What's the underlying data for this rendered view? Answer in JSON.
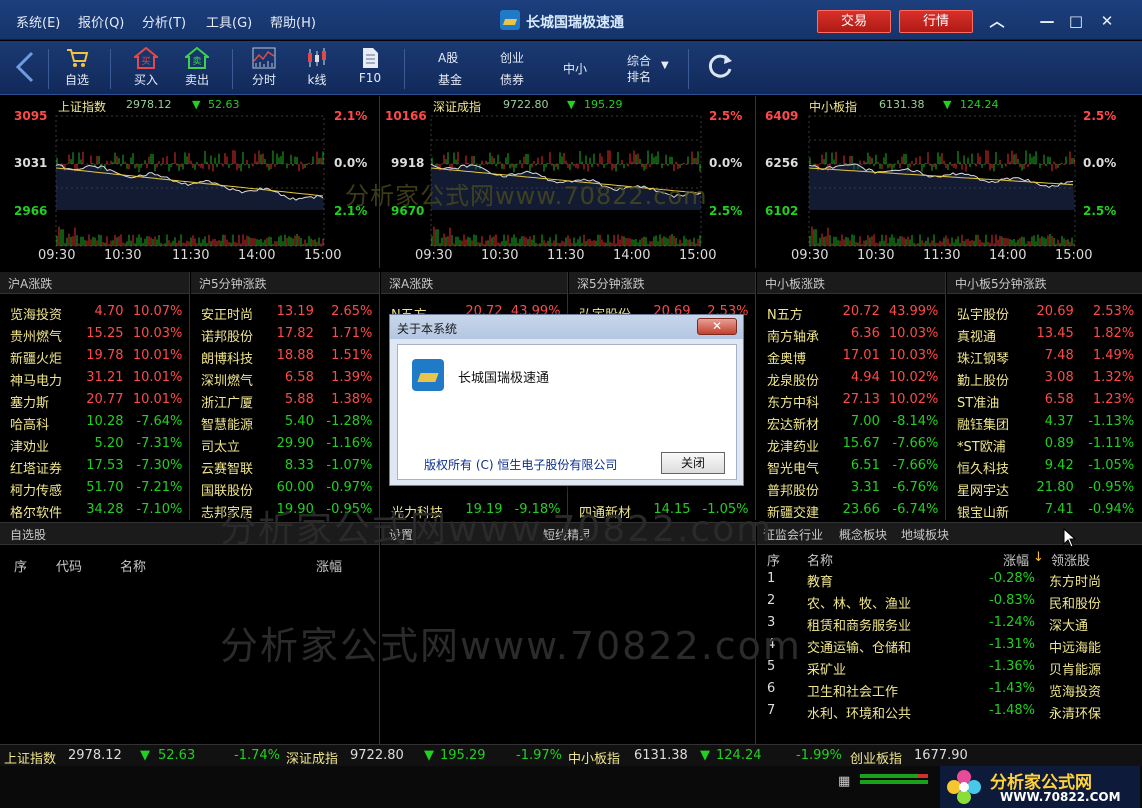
{
  "menu": [
    "系统(E)",
    "报价(Q)",
    "分析(T)",
    "工具(G)",
    "帮助(H)"
  ],
  "app_title": "长城国瑞极速通",
  "buttons": {
    "trade": "交易",
    "quote": "行情"
  },
  "toolbar": {
    "watch": "自选",
    "buy": "买入",
    "sell": "卖出",
    "timeshare": "分时",
    "kline": "k线",
    "f10": "F10",
    "a_share": "A股",
    "fund": "基金",
    "gem": "创业",
    "bond": "债券",
    "small": "中小",
    "rank": "综合",
    "rank2": "排名"
  },
  "indices": [
    {
      "name": "上证指数",
      "value": "2978.12",
      "change": "52.63",
      "top": "3095",
      "mid": "3031",
      "bot": "2966",
      "pct_top": "2.1%",
      "pct_mid": "0.0%",
      "pct_bot": "2.1%"
    },
    {
      "name": "深证成指",
      "value": "9722.80",
      "change": "195.29",
      "top": "10166",
      "mid": "9918",
      "bot": "9670",
      "pct_top": "2.5%",
      "pct_mid": "0.0%",
      "pct_bot": "2.5%"
    },
    {
      "name": "中小板指",
      "value": "6131.38",
      "change": "124.24",
      "top": "6409",
      "mid": "6256",
      "bot": "6102",
      "pct_top": "2.5%",
      "pct_mid": "0.0%",
      "pct_bot": "2.5%"
    }
  ],
  "times": [
    "09:30",
    "10:30",
    "11:30",
    "14:00",
    "15:00"
  ],
  "watermark": "分析家公式网www.70822.com",
  "watermark_dot": "分析家公式网www.70822.com",
  "sections": [
    {
      "title": "沪A涨跌",
      "rows": [
        [
          "览海投资",
          "4.70",
          "10.07%",
          "up"
        ],
        [
          "贵州燃气",
          "15.25",
          "10.03%",
          "up"
        ],
        [
          "新疆火炬",
          "19.78",
          "10.01%",
          "up"
        ],
        [
          "神马电力",
          "31.21",
          "10.01%",
          "up"
        ],
        [
          "塞力斯",
          "20.77",
          "10.01%",
          "up"
        ],
        [
          "哈高科",
          "10.28",
          "-7.64%",
          "dn"
        ],
        [
          "津劝业",
          "5.20",
          "-7.31%",
          "dn"
        ],
        [
          "红塔证券",
          "17.53",
          "-7.30%",
          "dn"
        ],
        [
          "柯力传感",
          "51.70",
          "-7.21%",
          "dn"
        ],
        [
          "格尔软件",
          "34.28",
          "-7.10%",
          "dn"
        ]
      ]
    },
    {
      "title": "沪5分钟涨跌",
      "rows": [
        [
          "安正时尚",
          "13.19",
          "2.65%",
          "up"
        ],
        [
          "诺邦股份",
          "17.82",
          "1.71%",
          "up"
        ],
        [
          "朗博科技",
          "18.88",
          "1.51%",
          "up"
        ],
        [
          "深圳燃气",
          "6.58",
          "1.39%",
          "up"
        ],
        [
          "浙江广厦",
          "5.88",
          "1.38%",
          "up"
        ],
        [
          "智慧能源",
          "5.40",
          "-1.28%",
          "dn"
        ],
        [
          "司太立",
          "29.90",
          "-1.16%",
          "dn"
        ],
        [
          "云赛智联",
          "8.33",
          "-1.07%",
          "dn"
        ],
        [
          "国联股份",
          "60.00",
          "-0.97%",
          "dn"
        ],
        [
          "志邦家居",
          "19.90",
          "-0.95%",
          "dn"
        ]
      ]
    },
    {
      "title": "深A涨跌",
      "rows": [
        [
          "N五方",
          "20.72",
          "43.99%",
          "up"
        ],
        [
          "",
          "",
          "",
          ""
        ],
        [
          "",
          "",
          "",
          ""
        ],
        [
          "",
          "",
          "",
          ""
        ],
        [
          "",
          "",
          "",
          ""
        ],
        [
          "",
          "",
          "",
          ""
        ],
        [
          "",
          "",
          "",
          ""
        ],
        [
          "",
          "",
          "",
          ""
        ],
        [
          "",
          "",
          "",
          ""
        ],
        [
          "光力科技",
          "19.19",
          "-9.18%",
          "dn"
        ]
      ]
    },
    {
      "title": "深5分钟涨跌",
      "rows": [
        [
          "弘宇股份",
          "20.69",
          "2.53%",
          "up"
        ],
        [
          "",
          "",
          "",
          ""
        ],
        [
          "",
          "",
          "",
          ""
        ],
        [
          "",
          "",
          "",
          ""
        ],
        [
          "",
          "",
          "",
          ""
        ],
        [
          "",
          "",
          "",
          ""
        ],
        [
          "",
          "",
          "",
          ""
        ],
        [
          "",
          "",
          "",
          ""
        ],
        [
          "",
          "",
          "",
          ""
        ],
        [
          "四通新材",
          "14.15",
          "-1.05%",
          "dn"
        ]
      ]
    },
    {
      "title": "中小板涨跌",
      "rows": [
        [
          "N五方",
          "20.72",
          "43.99%",
          "up"
        ],
        [
          "南方轴承",
          "6.36",
          "10.03%",
          "up"
        ],
        [
          "金奥博",
          "17.01",
          "10.03%",
          "up"
        ],
        [
          "龙泉股份",
          "4.94",
          "10.02%",
          "up"
        ],
        [
          "东方中科",
          "27.13",
          "10.02%",
          "up"
        ],
        [
          "宏达新材",
          "7.00",
          "-8.14%",
          "dn"
        ],
        [
          "龙津药业",
          "15.67",
          "-7.66%",
          "dn"
        ],
        [
          "智光电气",
          "6.51",
          "-7.66%",
          "dn"
        ],
        [
          "普邦股份",
          "3.31",
          "-6.76%",
          "dn"
        ],
        [
          "新疆交建",
          "23.66",
          "-6.74%",
          "dn"
        ]
      ]
    },
    {
      "title": "中小板5分钟涨跌",
      "rows": [
        [
          "弘宇股份",
          "20.69",
          "2.53%",
          "up"
        ],
        [
          "真视通",
          "13.45",
          "1.82%",
          "up"
        ],
        [
          "珠江钢琴",
          "7.48",
          "1.49%",
          "up"
        ],
        [
          "勤上股份",
          "3.08",
          "1.32%",
          "up"
        ],
        [
          "ST准油",
          "6.58",
          "1.23%",
          "up"
        ],
        [
          "融钰集团",
          "4.37",
          "-1.13%",
          "dn"
        ],
        [
          "*ST欧浦",
          "0.89",
          "-1.11%",
          "dn"
        ],
        [
          "恒久科技",
          "9.42",
          "-1.05%",
          "dn"
        ],
        [
          "星网宇达",
          "21.80",
          "-0.95%",
          "dn"
        ],
        [
          "银宝山新",
          "7.41",
          "-0.94%",
          "dn"
        ]
      ]
    }
  ],
  "watchlist": {
    "title": "自选股",
    "cols": [
      "序",
      "代码",
      "名称",
      "涨幅"
    ]
  },
  "middle": {
    "setting": "设置",
    "genie": "短线精灵"
  },
  "industry": {
    "tabs": [
      "证监会行业",
      "概念板块",
      "地域板块"
    ],
    "cols": [
      "序",
      "名称",
      "涨幅",
      "领涨股"
    ],
    "rows": [
      [
        "1",
        "教育",
        "-0.28%",
        "东方时尚"
      ],
      [
        "2",
        "农、林、牧、渔业",
        "-0.83%",
        "民和股份"
      ],
      [
        "3",
        "租赁和商务服务业",
        "-1.24%",
        "深大通"
      ],
      [
        "4",
        "交通运输、仓储和",
        "-1.31%",
        "中远海能"
      ],
      [
        "5",
        "采矿业",
        "-1.36%",
        "贝肯能源"
      ],
      [
        "6",
        "卫生和社会工作",
        "-1.43%",
        "览海投资"
      ],
      [
        "7",
        "水利、环境和公共",
        "-1.48%",
        "永清环保"
      ]
    ]
  },
  "status": [
    {
      "name": "上证指数",
      "value": "2978.12",
      "change": "52.63",
      "pct": "-1.74%"
    },
    {
      "name": "深证成指",
      "value": "9722.80",
      "change": "195.29",
      "pct": "-1.97%"
    },
    {
      "name": "中小板指",
      "value": "6131.38",
      "change": "124.24",
      "pct": "-1.99%"
    },
    {
      "name": "创业板指",
      "value": "1677.90",
      "change": "",
      "pct": ""
    }
  ],
  "dialog": {
    "title": "关于本系统",
    "close_x": "✕",
    "app_name": "长城国瑞极速通",
    "copyright": "版权所有 (C)  恒生电子股份有限公司",
    "close_btn": "关闭"
  },
  "footer_logo": {
    "text": "分析家公式网",
    "url": "WWW.70822.COM"
  }
}
